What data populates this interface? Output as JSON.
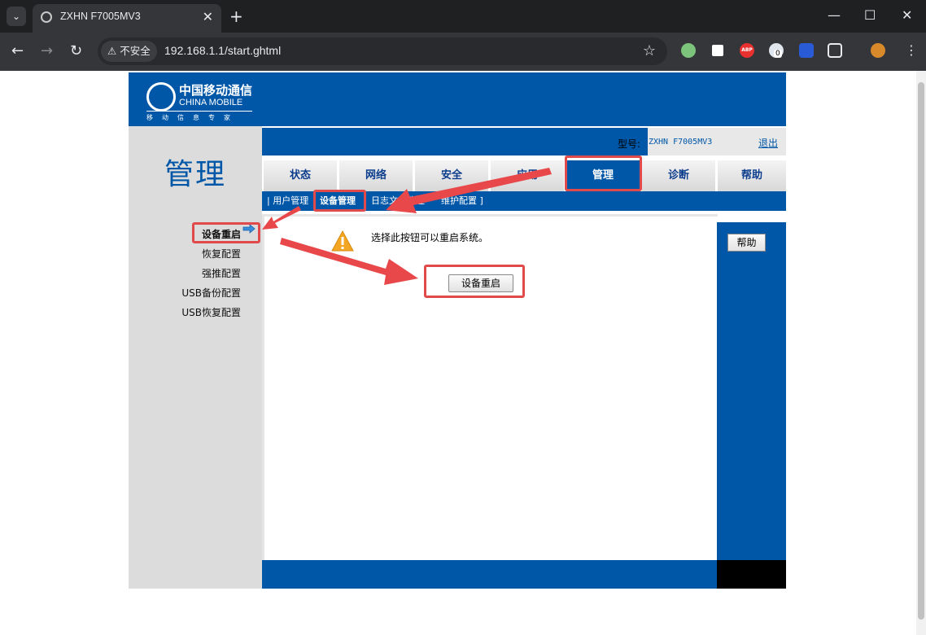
{
  "browser": {
    "tab_title": "ZXHN F7005MV3",
    "security_label": "不安全",
    "url": "192.168.1.1/start.ghtml",
    "ext_badge": "0",
    "abp_label": "ABP"
  },
  "logo": {
    "cn": "中国移动通信",
    "en": "CHINA MOBILE",
    "sub": "移动信息专家"
  },
  "page": {
    "section_title": "管理",
    "model_label": "型号:",
    "model_value": "ZXHN F7005MV3",
    "logout": "退出"
  },
  "nav": {
    "items": [
      "状态",
      "网络",
      "安全",
      "应用",
      "管理",
      "诊断",
      "帮助"
    ],
    "active": "管理"
  },
  "subnav": {
    "items": [
      "| 用户管理",
      "设备管理",
      "日志文件管理",
      "维护配置 ]"
    ],
    "active": "设备管理"
  },
  "sidebar": {
    "items": [
      "设备重启",
      "恢复配置",
      "强推配置",
      "USB备份配置",
      "USB恢复配置"
    ],
    "active": "设备重启"
  },
  "content": {
    "message": "选择此按钮可以重启系统。",
    "reboot_button": "设备重启",
    "help_button": "帮助"
  },
  "colors": {
    "brand_blue": "#0057a8",
    "annotation_red": "#e04a4a"
  }
}
